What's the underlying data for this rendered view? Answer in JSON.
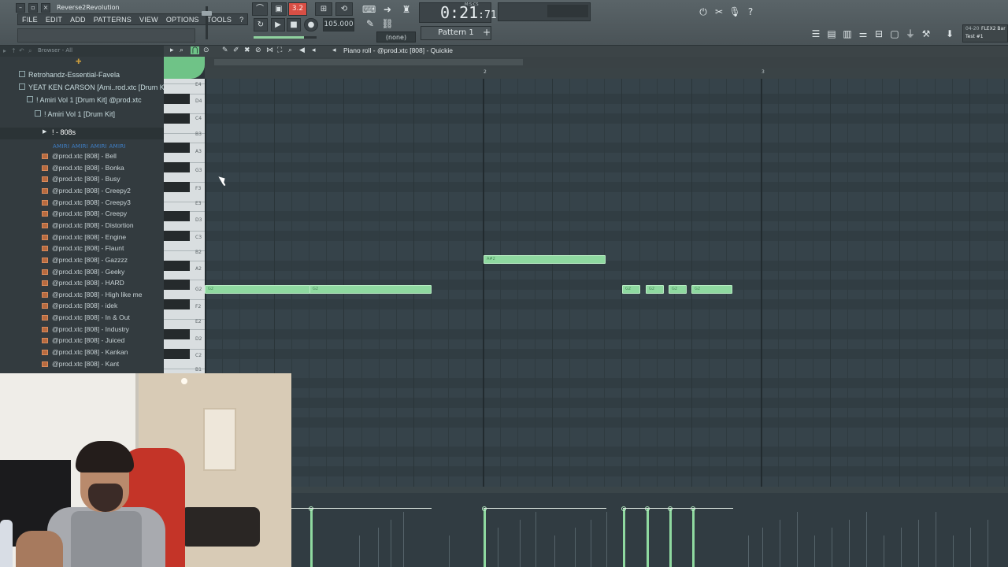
{
  "window": {
    "title": "Reverse2Revolution"
  },
  "menu": [
    "FILE",
    "EDIT",
    "ADD",
    "PATTERNS",
    "VIEW",
    "OPTIONS",
    "TOOLS",
    "?"
  ],
  "transport": {
    "mode_label": "3.2",
    "tempo": "105.000",
    "time": "0:21",
    "time_sub": ":71",
    "time_unit": "M:S:CS",
    "snap": "(none)",
    "pattern": "Pattern 1",
    "pattern_add": "+"
  },
  "news": {
    "date": "04-20",
    "title": "FLEX2 Bar",
    "subtitle": "Test #1"
  },
  "browser": {
    "header_label": "Browser - All",
    "plus": "✚",
    "folders": [
      {
        "label": "Retrohandz-Essential-Favela",
        "indent": 24
      },
      {
        "label": "YEAT KEN CARSON [Ami..rod.xtc [Drum Kit]",
        "indent": 24
      },
      {
        "label": "! Amiri Vol 1 [Drum Kit] @prod.xtc",
        "indent": 34
      },
      {
        "label": "! Amiri Vol 1 [Drum Kit]",
        "indent": 44
      },
      {
        "label": "! - 808s",
        "indent": 54
      }
    ],
    "drum_labels": "AMIRI AMIRI AMIRI AMIRI",
    "samples": [
      "@prod.xtc [808] - Bell",
      "@prod.xtc [808] - Bonka",
      "@prod.xtc [808] - Busy",
      "@prod.xtc [808] - Creepy2",
      "@prod.xtc [808] - Creepy3",
      "@prod.xtc [808] - Creepy",
      "@prod.xtc [808] - Distortion",
      "@prod.xtc [808] - Engine",
      "@prod.xtc [808] - Flaunt",
      "@prod.xtc [808] - Gazzzz",
      "@prod.xtc [808] - Geeky",
      "@prod.xtc [808] - HARD",
      "@prod.xtc [808] - High like me",
      "@prod.xtc [808] - idek",
      "@prod.xtc [808] - In & Out",
      "@prod.xtc [808] - Industry",
      "@prod.xtc [808] - Juiced",
      "@prod.xtc [808] - Kankan",
      "@prod.xtc [808] - Kant"
    ]
  },
  "piano_roll": {
    "title": "Piano roll - @prod.xtc [808] - Quickie",
    "bars": [
      "2",
      "3"
    ],
    "keys": [
      "E4",
      "D4",
      "C4",
      "B3",
      "A3",
      "G3",
      "F3",
      "E3",
      "D3",
      "C3",
      "B2",
      "A2",
      "G2",
      "F2",
      "E2",
      "D2",
      "C2",
      "B1"
    ],
    "notes": [
      {
        "label": "G2"
      },
      {
        "label": "G2"
      },
      {
        "label": "A#2"
      },
      {
        "label": "G2"
      },
      {
        "label": "G2"
      },
      {
        "label": "G2"
      },
      {
        "label": "G2"
      }
    ]
  },
  "colors": {
    "note": "#8fd9a0",
    "accent": "#d94f45",
    "grid": "#36434a"
  }
}
